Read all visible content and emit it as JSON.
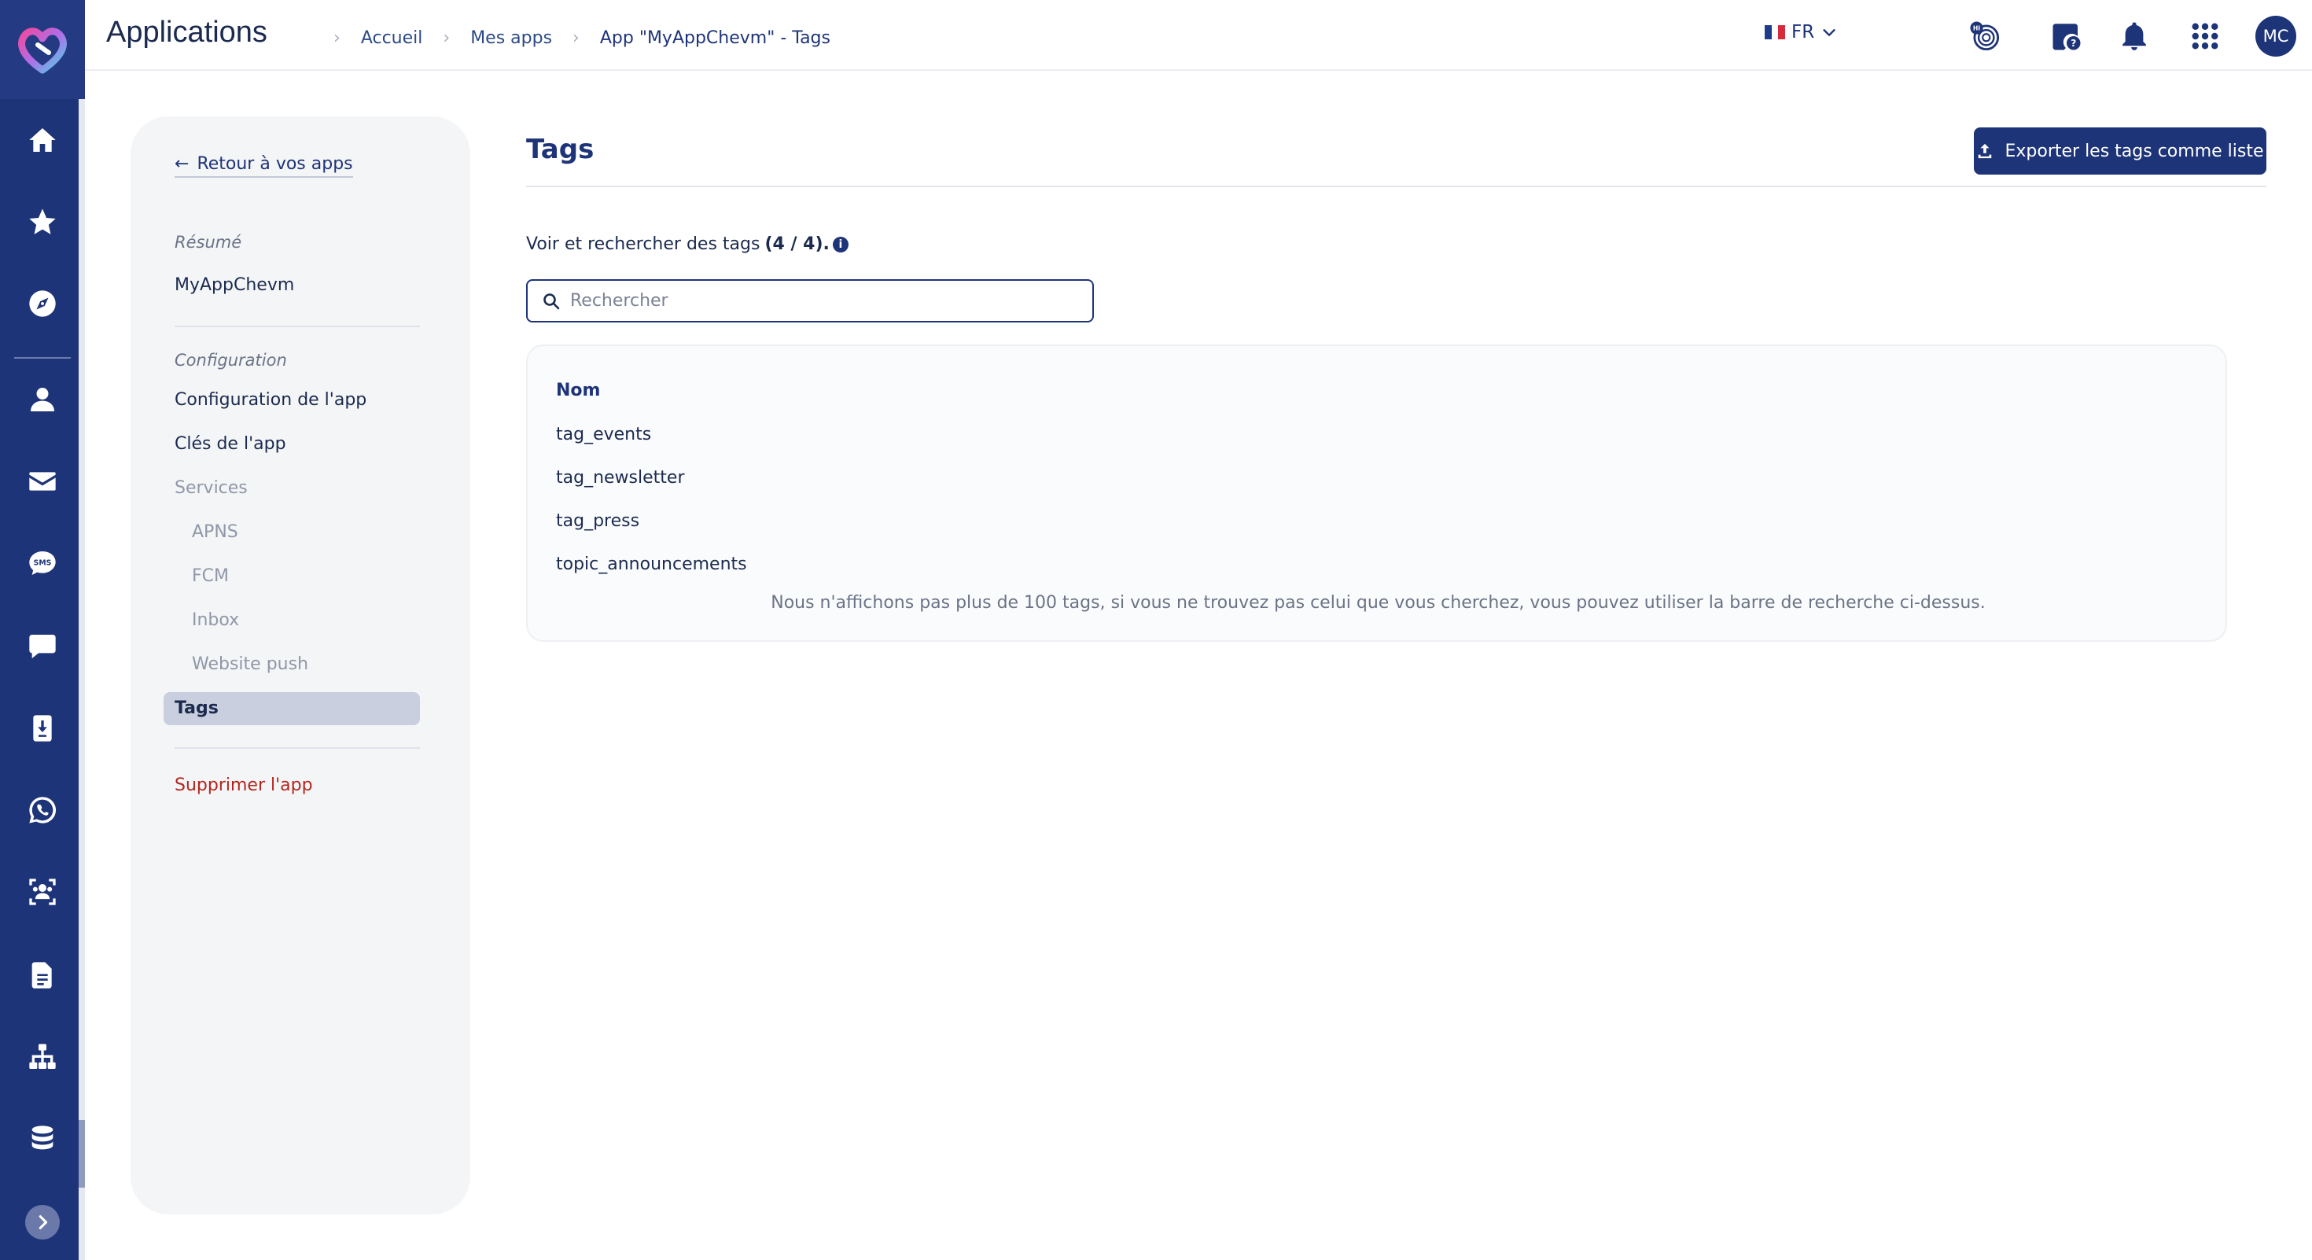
{
  "header": {
    "title": "Applications",
    "breadcrumb": [
      "Accueil",
      "Mes apps",
      "App \"MyAppChevm\" - Tags"
    ],
    "language": "FR",
    "avatar_initials": "MC",
    "icons": [
      "whats-new-icon",
      "help-icon",
      "bell-icon",
      "apps-grid-icon"
    ]
  },
  "rail": {
    "icons": [
      "home-icon",
      "star-icon",
      "compass-icon",
      "user-icon",
      "email-icon",
      "sms-icon",
      "chat-icon",
      "mobile-download-icon",
      "whatsapp-icon",
      "audience-icon",
      "document-icon",
      "sitemap-icon",
      "database-icon"
    ]
  },
  "sidebar": {
    "back_label": "Retour à vos apps",
    "summary_heading": "Résumé",
    "app_name": "MyAppChevm",
    "config_heading": "Configuration",
    "items": {
      "app_config": "Configuration de l'app",
      "app_keys": "Clés de l'app",
      "services": "Services",
      "apns": "APNS",
      "fcm": "FCM",
      "inbox": "Inbox",
      "website_push": "Website push",
      "tags": "Tags",
      "delete_app": "Supprimer l'app"
    }
  },
  "main": {
    "title": "Tags",
    "export_label": "Exporter les tags comme liste",
    "subtitle_text": "Voir et rechercher des tags",
    "subtitle_count": "(4 / 4).",
    "search_placeholder": "Rechercher",
    "table": {
      "column": "Nom",
      "rows": [
        "tag_events",
        "tag_newsletter",
        "tag_press",
        "topic_announcements"
      ],
      "note": "Nous n'affichons pas plus de 100 tags, si vous ne trouvez pas celui que vous cherchez, vous pouvez utiliser la barre de recherche ci-dessus."
    }
  },
  "colors": {
    "brand": "#1e3478",
    "danger": "#b3261e",
    "panel": "#f4f5f7"
  }
}
